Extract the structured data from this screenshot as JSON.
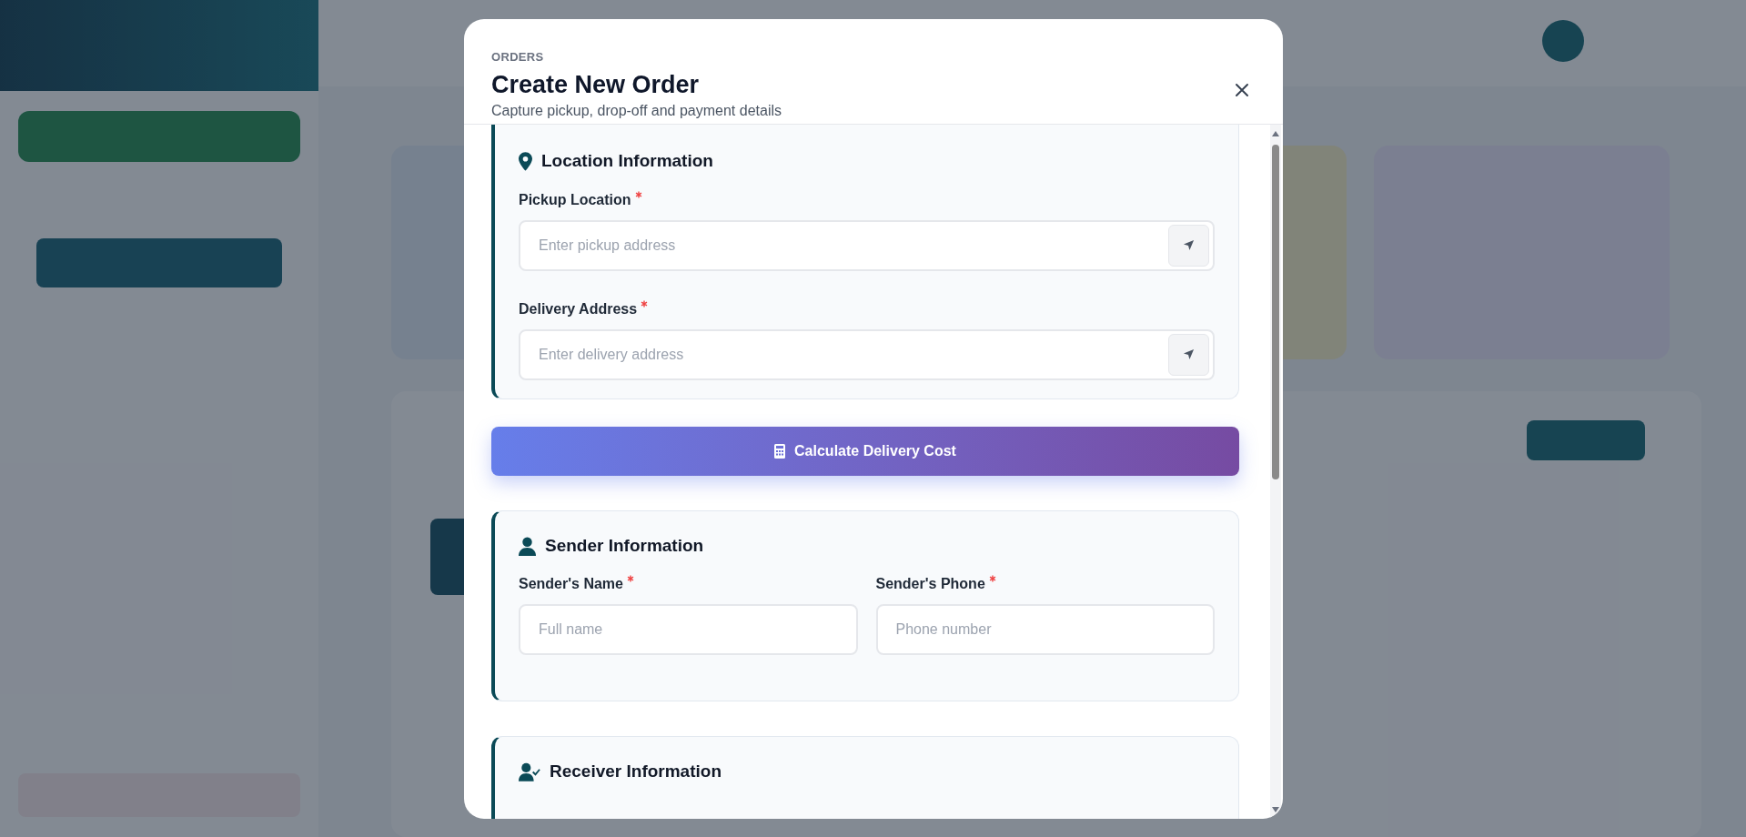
{
  "modal": {
    "eyebrow": "ORDERS",
    "title": "Create New Order",
    "subtitle": "Capture pickup, drop-off and payment details"
  },
  "body": [
    {
      "kind": "section",
      "title": "Location Information",
      "fields": [
        {
          "kind": "location",
          "label": "Pickup Location",
          "required": true,
          "placeholder": "Enter pickup address"
        },
        {
          "kind": "location",
          "label": "Delivery Address",
          "required": true,
          "placeholder": "Enter delivery address"
        }
      ]
    },
    {
      "kind": "button",
      "label": "Calculate Delivery Cost"
    },
    {
      "kind": "section",
      "title": "Sender Information",
      "fields": [
        {
          "kind": "half",
          "label": "Sender's Name",
          "required": true,
          "placeholder": "Full name"
        },
        {
          "kind": "half",
          "label": "Sender's Phone",
          "required": true,
          "placeholder": "Phone number"
        }
      ]
    },
    {
      "kind": "section",
      "title": "Receiver Information"
    }
  ]
}
